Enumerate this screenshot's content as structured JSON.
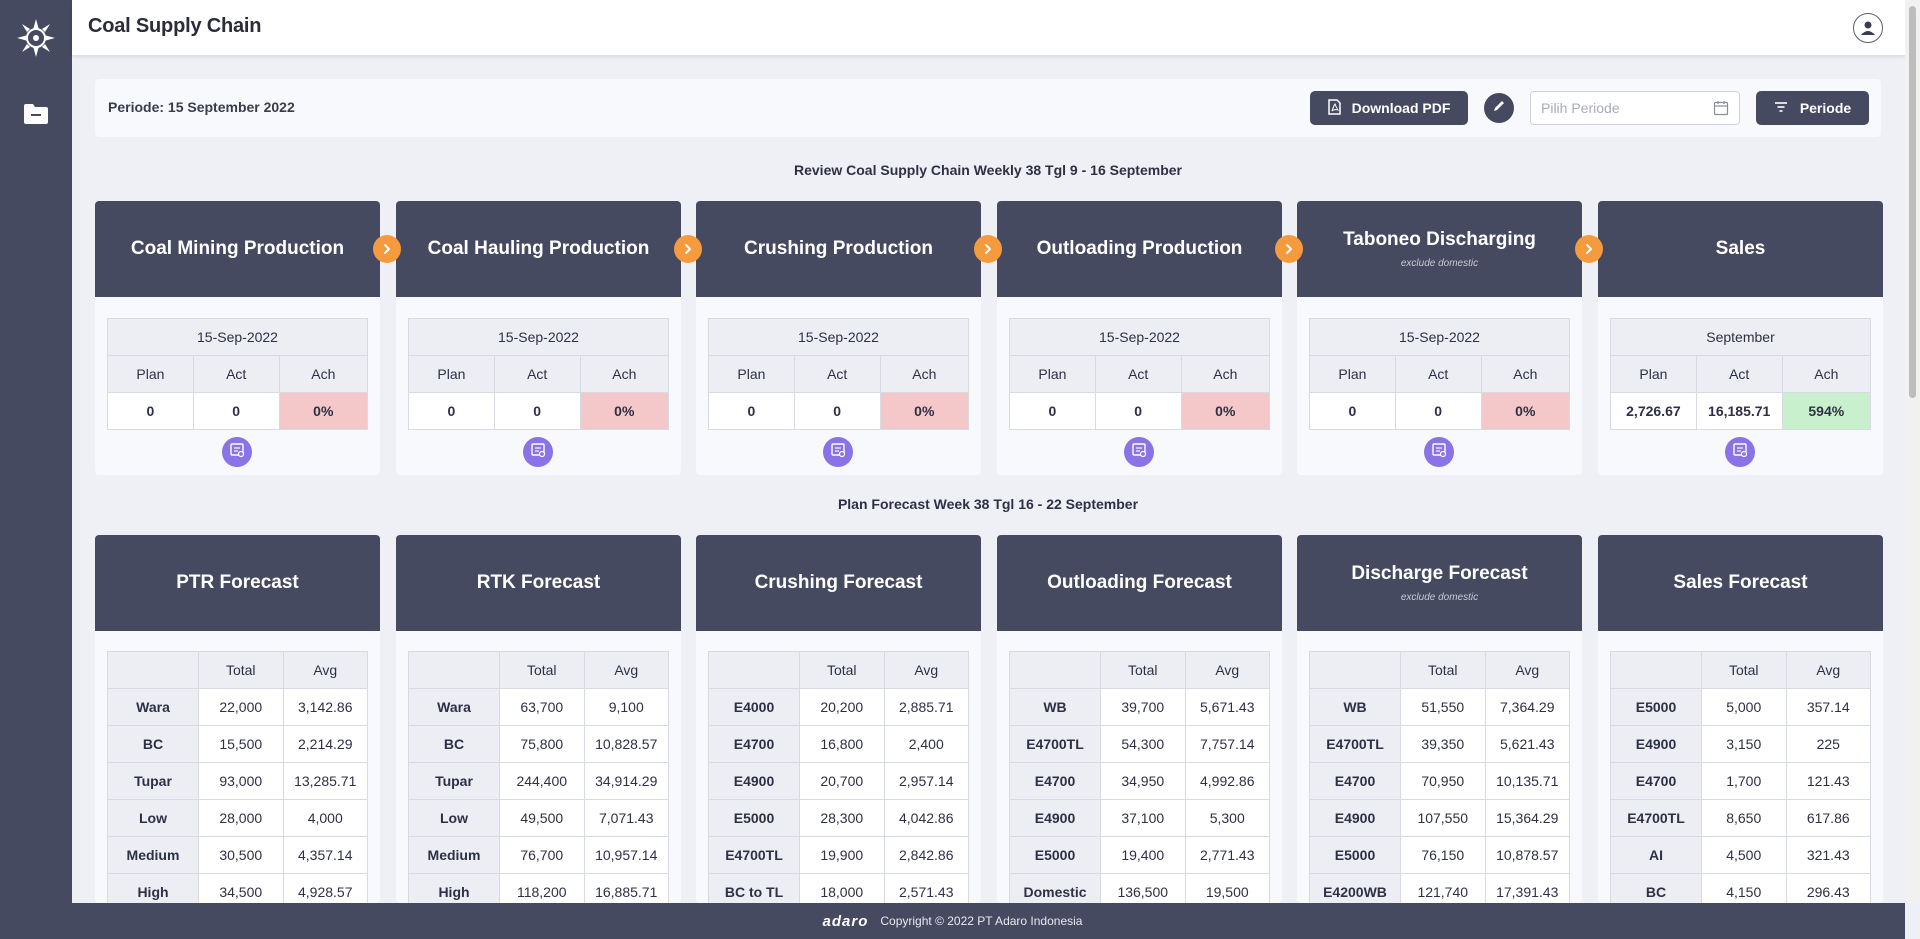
{
  "app": {
    "title": "Coal Supply Chain"
  },
  "filter": {
    "periode_label": "Periode: 15 September 2022",
    "download_label": "Download PDF",
    "input_placeholder": "Pilih Periode",
    "periode_button": "Periode"
  },
  "review": {
    "title": "Review Coal Supply Chain Weekly 38 Tgl 9 - 16 September",
    "columns": [
      "Plan",
      "Act",
      "Ach"
    ],
    "cards": [
      {
        "title": "Coal Mining Production",
        "subtitle": "",
        "date": "15-Sep-2022",
        "plan": "0",
        "act": "0",
        "ach": "0%",
        "status": "bad"
      },
      {
        "title": "Coal Hauling Production",
        "subtitle": "",
        "date": "15-Sep-2022",
        "plan": "0",
        "act": "0",
        "ach": "0%",
        "status": "bad"
      },
      {
        "title": "Crushing Production",
        "subtitle": "",
        "date": "15-Sep-2022",
        "plan": "0",
        "act": "0",
        "ach": "0%",
        "status": "bad"
      },
      {
        "title": "Outloading Production",
        "subtitle": "",
        "date": "15-Sep-2022",
        "plan": "0",
        "act": "0",
        "ach": "0%",
        "status": "bad"
      },
      {
        "title": "Taboneo Discharging",
        "subtitle": "exclude domestic",
        "date": "15-Sep-2022",
        "plan": "0",
        "act": "0",
        "ach": "0%",
        "status": "bad"
      },
      {
        "title": "Sales",
        "subtitle": "",
        "date": "September",
        "plan": "2,726.67",
        "act": "16,185.71",
        "ach": "594%",
        "status": "good"
      }
    ]
  },
  "forecast": {
    "title": "Plan Forecast Week 38 Tgl 16 - 22 September",
    "columns": [
      "",
      "Total",
      "Avg"
    ],
    "cards": [
      {
        "title": "PTR Forecast",
        "subtitle": "",
        "rows": [
          [
            "Wara",
            "22,000",
            "3,142.86"
          ],
          [
            "BC",
            "15,500",
            "2,214.29"
          ],
          [
            "Tupar",
            "93,000",
            "13,285.71"
          ],
          [
            "Low",
            "28,000",
            "4,000"
          ],
          [
            "Medium",
            "30,500",
            "4,357.14"
          ],
          [
            "High",
            "34,500",
            "4,928.57"
          ]
        ]
      },
      {
        "title": "RTK Forecast",
        "subtitle": "",
        "rows": [
          [
            "Wara",
            "63,700",
            "9,100"
          ],
          [
            "BC",
            "75,800",
            "10,828.57"
          ],
          [
            "Tupar",
            "244,400",
            "34,914.29"
          ],
          [
            "Low",
            "49,500",
            "7,071.43"
          ],
          [
            "Medium",
            "76,700",
            "10,957.14"
          ],
          [
            "High",
            "118,200",
            "16,885.71"
          ]
        ]
      },
      {
        "title": "Crushing Forecast",
        "subtitle": "",
        "rows": [
          [
            "E4000",
            "20,200",
            "2,885.71"
          ],
          [
            "E4700",
            "16,800",
            "2,400"
          ],
          [
            "E4900",
            "20,700",
            "2,957.14"
          ],
          [
            "E5000",
            "28,300",
            "4,042.86"
          ],
          [
            "E4700TL",
            "19,900",
            "2,842.86"
          ],
          [
            "BC to TL",
            "18,000",
            "2,571.43"
          ]
        ]
      },
      {
        "title": "Outloading Forecast",
        "subtitle": "",
        "rows": [
          [
            "WB",
            "39,700",
            "5,671.43"
          ],
          [
            "E4700TL",
            "54,300",
            "7,757.14"
          ],
          [
            "E4700",
            "34,950",
            "4,992.86"
          ],
          [
            "E4900",
            "37,100",
            "5,300"
          ],
          [
            "E5000",
            "19,400",
            "2,771.43"
          ],
          [
            "Domestic",
            "136,500",
            "19,500"
          ]
        ]
      },
      {
        "title": "Discharge Forecast",
        "subtitle": "exclude domestic",
        "rows": [
          [
            "WB",
            "51,550",
            "7,364.29"
          ],
          [
            "E4700TL",
            "39,350",
            "5,621.43"
          ],
          [
            "E4700",
            "70,950",
            "10,135.71"
          ],
          [
            "E4900",
            "107,550",
            "15,364.29"
          ],
          [
            "E5000",
            "76,150",
            "10,878.57"
          ],
          [
            "E4200WB",
            "121,740",
            "17,391.43"
          ]
        ]
      },
      {
        "title": "Sales Forecast",
        "subtitle": "",
        "rows": [
          [
            "E5000",
            "5,000",
            "357.14"
          ],
          [
            "E4900",
            "3,150",
            "225"
          ],
          [
            "E4700",
            "1,700",
            "121.43"
          ],
          [
            "E4700TL",
            "8,650",
            "617.86"
          ],
          [
            "AI",
            "4,500",
            "321.43"
          ],
          [
            "BC",
            "4,150",
            "296.43"
          ]
        ]
      }
    ]
  },
  "footer": {
    "logo": "adaro",
    "copyright": "Copyright © 2022 PT Adaro Indonesia"
  },
  "colors": {
    "primary": "#464a60",
    "accent_arrow": "#f59a3d",
    "detail_button": "#8a73e6",
    "ach_bad": "#f4c7c8",
    "ach_good": "#c9f0cc"
  },
  "icons": {
    "logo": "compass-logo-icon",
    "folder": "folder-icon",
    "user": "user-circle-icon",
    "pdf": "pdf-file-icon",
    "edit": "pencil-icon",
    "calendar": "calendar-icon",
    "filter": "filter-lines-icon",
    "arrow": "chevron-right-icon",
    "detail": "report-icon"
  }
}
